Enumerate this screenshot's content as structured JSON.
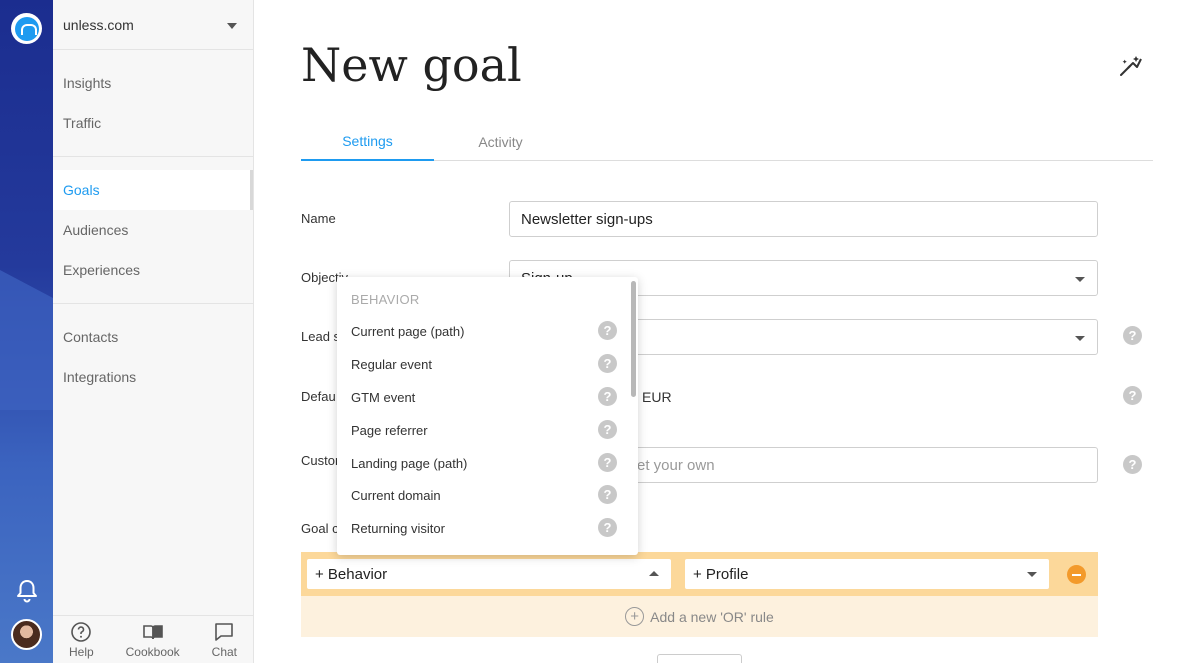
{
  "sidebar": {
    "site": "unless.com",
    "groups": [
      [
        "Insights",
        "Traffic"
      ],
      [
        "Goals",
        "Audiences",
        "Experiences"
      ],
      [
        "Contacts",
        "Integrations"
      ]
    ],
    "active": "Goals",
    "bottom": {
      "help": "Help",
      "cookbook": "Cookbook",
      "chat": "Chat"
    }
  },
  "page": {
    "title": "New goal",
    "tabs": [
      "Settings",
      "Activity"
    ]
  },
  "form": {
    "name_label": "Name",
    "name_value": "Newsletter sign-ups",
    "objective_label": "Objectiv",
    "objective_value": "Sign-up",
    "lead_label": "Lead s",
    "default_label": "Defau",
    "default_value": "EUR",
    "custom_label": "Custor",
    "custom_placeholder": "et your own",
    "goal_label": "Goal c"
  },
  "rules": {
    "behavior_select": "+ Behavior",
    "profile_select": "+ Profile",
    "add_or": "Add a new 'OR' rule"
  },
  "dropdown": {
    "header": "BEHAVIOR",
    "items": [
      "Current page (path)",
      "Regular event",
      "GTM event",
      "Page referrer",
      "Landing page (path)",
      "Current domain",
      "Returning visitor"
    ]
  },
  "colors": {
    "accent": "#1e9bf0",
    "rules_bar": "#fcd89a",
    "or_bar": "#fdf1de",
    "remove": "#f39a2b"
  }
}
